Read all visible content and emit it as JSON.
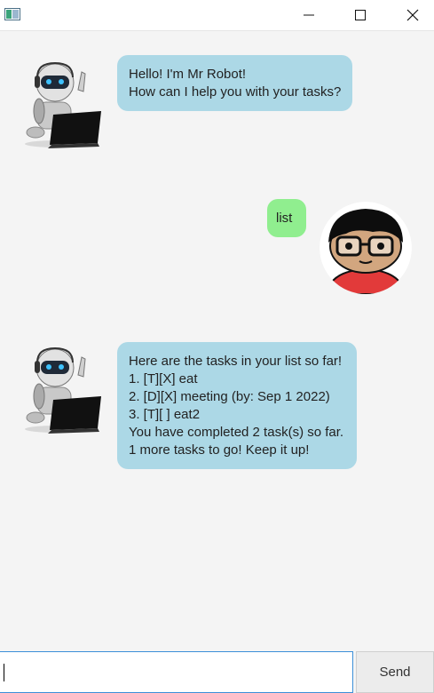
{
  "window": {
    "icon": "java-app-icon",
    "controls": [
      "minimize-icon",
      "maximize-icon",
      "close-icon"
    ]
  },
  "messages": [
    {
      "sender": "bot",
      "avatar": "robot-icon",
      "lines": [
        "Hello! I'm Mr Robot!",
        "How can I help you with your tasks?"
      ]
    },
    {
      "sender": "user",
      "avatar": "user-avatar-icon",
      "lines": [
        "list"
      ]
    },
    {
      "sender": "bot",
      "avatar": "robot-icon",
      "lines": [
        "Here are the tasks in your list so far!",
        "1. [T][X] eat",
        "2. [D][X] meeting (by: Sep 1 2022)",
        "3. [T][ ] eat2",
        "You have completed 2 task(s) so far.",
        "1 more tasks to go! Keep it up!"
      ]
    }
  ],
  "input": {
    "value": "",
    "placeholder": ""
  },
  "send_button": {
    "label": "Send"
  },
  "colors": {
    "bot_bubble": "#acd8e6",
    "user_bubble": "#90ee8f",
    "background": "#f4f4f4",
    "input_focus_border": "#3c8fd8"
  }
}
